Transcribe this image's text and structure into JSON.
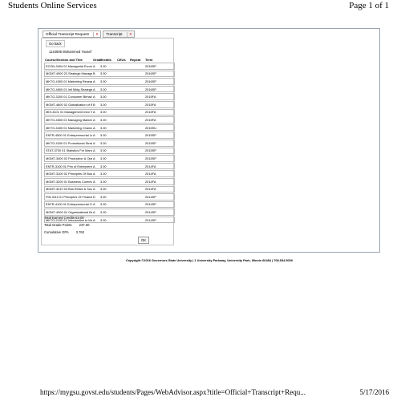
{
  "print": {
    "title": "Students Online Services",
    "page": "Page 1 of 1",
    "url": "https://mygsu.govst.edu/students/Pages/WebAdvisor.aspx?title=Official+Transcript+Requ...",
    "date": "5/17/2016"
  },
  "tabs": [
    {
      "label": "Official Transcript Request",
      "close": "x"
    },
    {
      "label": "Transcript",
      "close": "x"
    }
  ],
  "go_back_label": "Go back",
  "student_line": "1144606 Mohammed Yousef",
  "table": {
    "headers": [
      "Course/Section and Title",
      "Grade",
      "Credits",
      "CEUs",
      "Repeat",
      "Term"
    ],
    "rows": [
      [
        "ECON-3404 01 Managerial Economics",
        "A",
        "3.00",
        "",
        "",
        "2016SP"
      ],
      [
        "MGMT-4900 23 Strategic Management",
        "B",
        "3.00",
        "",
        "",
        "2016SP"
      ],
      [
        "MKTG-4300 01 Marketing Research",
        "A",
        "3.00",
        "",
        "",
        "2016SP"
      ],
      [
        "MKTG-4600 01 Intl Mktg Strategies",
        "A",
        "3.00",
        "",
        "",
        "2016SP"
      ],
      [
        "MKTG-3200 01 Consumer Behavior",
        "A",
        "3.00",
        "",
        "",
        "2015FA"
      ],
      [
        "MGMT-4600 02 Globalization of Business",
        "B",
        "3.00",
        "",
        "",
        "2015FA"
      ],
      [
        "MIS-3101 01 Management Infor Systms",
        "A",
        "3.00",
        "",
        "",
        "2015FA"
      ],
      [
        "MKTG-4500 01 Managing Market Strategies",
        "A",
        "3.00",
        "",
        "",
        "2015FA"
      ],
      [
        "MKTG-4400 01 Marketing Channel Management",
        "A",
        "3.00",
        "",
        "",
        "2015SU"
      ],
      [
        "ENTR-4500 01 Entrepreneurial Leadership",
        "A",
        "3.00",
        "",
        "",
        "2015SP"
      ],
      [
        "MKTG-4200 01 Promotional Strategies",
        "A",
        "3.00",
        "",
        "",
        "2015SP"
      ],
      [
        "STAT-3700 01 Statistics For Management II",
        "A",
        "3.00",
        "",
        "",
        "2015SP"
      ],
      [
        "MGMT-3400 02 Production & Operations Mgmt",
        "A",
        "3.00",
        "",
        "",
        "2015SP"
      ],
      [
        "ENTR-3100 01 Prin of Entrepreneurship",
        "A",
        "3.00",
        "",
        "",
        "2014FA"
      ],
      [
        "MGMT-3100 02 Principles Of Business Mgmt",
        "A",
        "3.00",
        "",
        "",
        "2014FA"
      ],
      [
        "MGMT-3200 01 Business Communications",
        "A",
        "3.00",
        "",
        "",
        "2014FA"
      ],
      [
        "MGMT-3210 03 Bus Ethics & Social Resp",
        "A",
        "3.00",
        "",
        "",
        "2014FA"
      ],
      [
        "FIN-3110 01 Principles Of Financial Mgmt",
        "D",
        "3.00",
        "",
        "",
        "2014SP"
      ],
      [
        "ENTR-4100 01 Entrepreneurial Opportunity",
        "A",
        "3.00",
        "",
        "",
        "2014SP"
      ],
      [
        "MGMT-4000 01 Organizational Behavior",
        "A",
        "3.00",
        "",
        "",
        "2014SP"
      ],
      [
        "MKTG-2100 01 Introduction to Marketing",
        "A",
        "3.00",
        "",
        "",
        "2014SP"
      ]
    ]
  },
  "summary": {
    "earned_credits_label": "Total Earned Credits",
    "earned_credits": "63.00",
    "grade_points_label": "Total Grade Points",
    "grade_points": "237.00",
    "gpa_label": "Cumulative GPA",
    "gpa": "3.762"
  },
  "ok_label": "OK",
  "copyright": "Copyright ©2016 Governors State University | 1 University Parkway, University Park, Illinois 60484 | 708.534.5000"
}
